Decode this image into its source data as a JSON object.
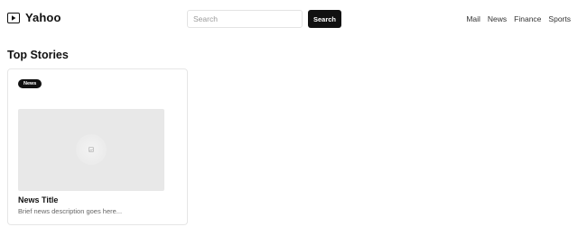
{
  "header": {
    "brand": "Yahoo",
    "brand_icon": "play-box-icon",
    "search": {
      "placeholder": "Search",
      "value": "",
      "button_label": "Search"
    },
    "nav": [
      {
        "label": "Mail"
      },
      {
        "label": "News"
      },
      {
        "label": "Finance"
      },
      {
        "label": "Sports"
      }
    ]
  },
  "main": {
    "section_title": "Top Stories",
    "cards": [
      {
        "badge": "News",
        "image_icon": "image-placeholder-icon",
        "title": "News Title",
        "description": "Brief news description goes here..."
      }
    ]
  },
  "colors": {
    "primary": "#111111",
    "card_border": "#e6e6e6",
    "media_bg": "#e8e8e8",
    "muted_text": "#666666"
  }
}
